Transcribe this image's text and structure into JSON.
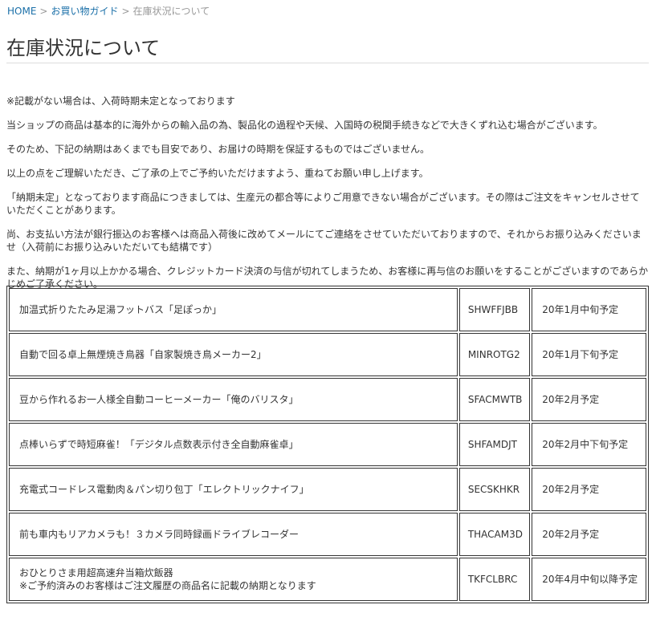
{
  "breadcrumb": {
    "home": "HOME",
    "separator": ">",
    "guide": "お買い物ガイド",
    "current": "在庫状況について"
  },
  "page_title": "在庫状況について",
  "notes": [
    "※記載がない場合は、入荷時期未定となっております",
    "当ショップの商品は基本的に海外からの輸入品の為、製品化の過程や天候、入国時の税関手続きなどで大きくずれ込む場合がございます。",
    "そのため、下記の納期はあくまでも目安であり、お届けの時期を保証するものではございません。",
    "以上の点をご理解いただき、ご了承の上でご予約いただけますよう、重ねてお願い申し上げます。",
    "「納期未定」となっております商品につきましては、生産元の都合等によりご用意できない場合がございます。その際はご注文をキャンセルさせていただくことがあります。",
    "尚、お支払い方法が銀行振込のお客様へは商品入荷後に改めてメールにてご連絡をさせていただいておりますので、それからお振り込みくださいませ（入荷前にお振り込みいただいても結構です）",
    "また、納期が1ヶ月以上かかる場合、クレジットカード決済の与信が切れてしまうため、お客様に再与信のお願いをすることがございますのであらかじめご了承ください。"
  ],
  "products": [
    {
      "name": "加温式折りたたみ足湯フットバス「足ぽっか」",
      "code": "SHWFFJBB",
      "schedule": "20年1月中旬予定"
    },
    {
      "name": "自動で回る卓上無煙焼き鳥器「自家製焼き鳥メーカー2」",
      "code": "MINROTG2",
      "schedule": "20年1月下旬予定"
    },
    {
      "name": "豆から作れるお一人様全自動コーヒーメーカー「俺のバリスタ」",
      "code": "SFACMWTB",
      "schedule": "20年2月予定"
    },
    {
      "name": "点棒いらずで時短麻雀！「デジタル点数表示付き全自動麻雀卓」",
      "code": "SHFAMDJT",
      "schedule": "20年2月中下旬予定"
    },
    {
      "name": "充電式コードレス電動肉＆パン切り包丁「エレクトリックナイフ」",
      "code": "SECSKHKR",
      "schedule": "20年2月予定"
    },
    {
      "name": "前も車内もリアカメラも！３カメラ同時録画ドライブレコーダー",
      "code": "THACAM3D",
      "schedule": "20年2月予定"
    },
    {
      "name": "おひとりさま用超高速弁当箱炊飯器",
      "note": "※ご予約済みのお客様はご注文履歴の商品名に記載の納期となります",
      "code": "TKFCLBRC",
      "schedule": "20年4月中旬以降予定"
    }
  ]
}
